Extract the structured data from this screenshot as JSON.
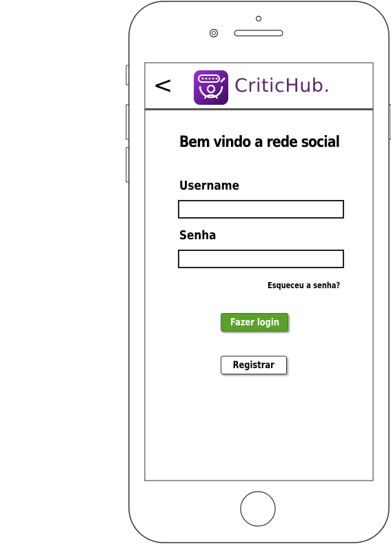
{
  "header": {
    "back_label": "<",
    "brand_name": "CriticHub."
  },
  "form": {
    "title": "Bem vindo a rede social",
    "username_label": "Username",
    "username_value": "",
    "password_label": "Senha",
    "password_value": "",
    "forgot_link": "Esqueceu a senha?",
    "login_button": "Fazer login",
    "register_button": "Registrar"
  },
  "colors": {
    "brand": "#5a2a6b",
    "logo_gradient_start": "#8a2be2",
    "logo_gradient_end": "#4b1069",
    "login_button": "#5aa02c"
  },
  "icons": {
    "back": "chevron-left-icon",
    "logo": "critichub-logo-icon"
  }
}
